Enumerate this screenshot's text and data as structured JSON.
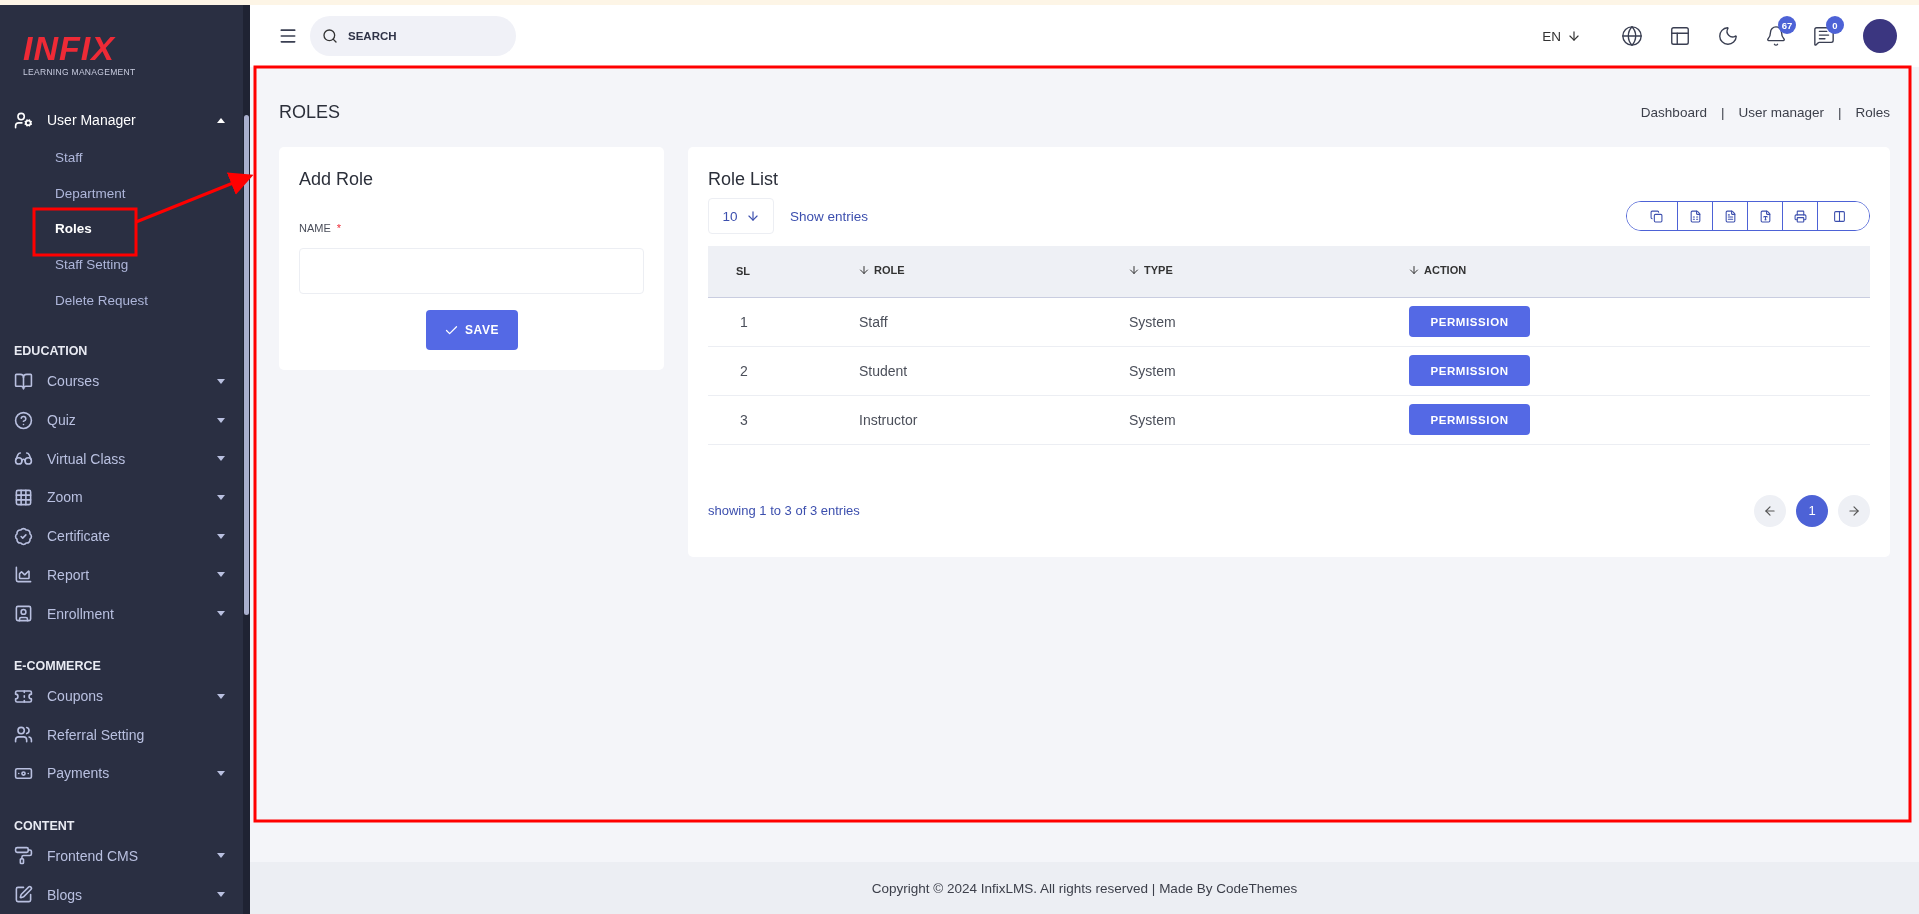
{
  "sidebar": {
    "logo": {
      "wordmark": "INFIX",
      "tagline": "LEARNING MANAGEMENT"
    },
    "sections": [
      {
        "items": [
          {
            "label": "User Manager",
            "kind": "menu",
            "expanded": true,
            "children": [
              {
                "label": "Staff",
                "selected": false
              },
              {
                "label": "Department",
                "selected": false
              },
              {
                "label": "Roles",
                "selected": true
              },
              {
                "label": "Staff Setting",
                "selected": false
              },
              {
                "label": "Delete Request",
                "selected": false
              }
            ]
          }
        ]
      },
      {
        "heading": "EDUCATION",
        "items": [
          {
            "label": "Courses",
            "kind": "menu",
            "expanded": false
          },
          {
            "label": "Quiz",
            "kind": "menu",
            "expanded": false
          },
          {
            "label": "Virtual Class",
            "kind": "menu",
            "expanded": false
          },
          {
            "label": "Zoom",
            "kind": "menu",
            "expanded": false
          },
          {
            "label": "Certificate",
            "kind": "menu",
            "expanded": false
          },
          {
            "label": "Report",
            "kind": "menu",
            "expanded": false
          },
          {
            "label": "Enrollment",
            "kind": "menu",
            "expanded": false
          }
        ]
      },
      {
        "heading": "E-COMMERCE",
        "items": [
          {
            "label": "Coupons",
            "kind": "menu",
            "expanded": false
          },
          {
            "label": "Referral Setting",
            "kind": "link"
          },
          {
            "label": "Payments",
            "kind": "menu",
            "expanded": false
          }
        ]
      },
      {
        "heading": "CONTENT",
        "items": [
          {
            "label": "Frontend CMS",
            "kind": "menu",
            "expanded": false
          },
          {
            "label": "Blogs",
            "kind": "menu",
            "expanded": false
          }
        ]
      }
    ]
  },
  "header": {
    "search": {
      "placeholder": "SEARCH"
    },
    "language": "EN",
    "notifications": "67",
    "messages": "0"
  },
  "page": {
    "title": "ROLES",
    "breadcrumb": [
      "Dashboard",
      "User manager",
      "Roles"
    ],
    "breadcrumb_separator": "|"
  },
  "add_role": {
    "title": "Add Role",
    "field": {
      "label": "NAME",
      "required_mark": "*"
    },
    "button": "SAVE"
  },
  "role_list": {
    "title": "Role List",
    "page_size": "10",
    "page_size_label": "Show entries",
    "columns": [
      {
        "label": "SL",
        "sortable": false
      },
      {
        "label": "ROLE",
        "sortable": true
      },
      {
        "label": "TYPE",
        "sortable": true
      },
      {
        "label": "ACTION",
        "sortable": true
      }
    ],
    "rows": [
      {
        "sl": "1",
        "role": "Staff",
        "type": "System",
        "action": "PERMISSION"
      },
      {
        "sl": "2",
        "role": "Student",
        "type": "System",
        "action": "PERMISSION"
      },
      {
        "sl": "3",
        "role": "Instructor",
        "type": "System",
        "action": "PERMISSION"
      }
    ],
    "summary": "showing 1 to 3 of 3 entries",
    "pages": [
      {
        "label": "1",
        "selected": true
      }
    ]
  },
  "footer": {
    "text": "Copyright © 2024 InfixLMS. All rights reserved | Made By CodeThemes"
  }
}
